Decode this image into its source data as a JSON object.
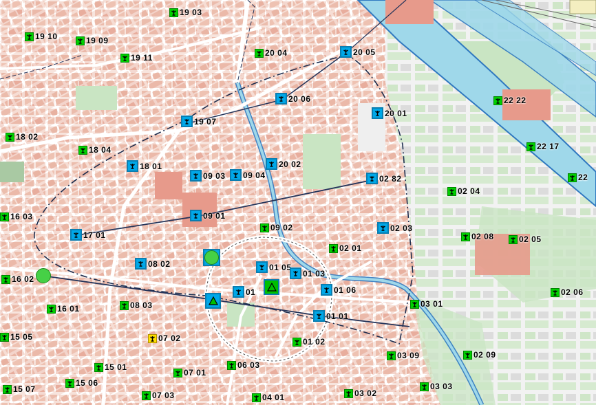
{
  "colors": {
    "urban_block": "#e9b7a6",
    "urban_block_dark": "#e9968a",
    "street": "#ffffff",
    "park": "#c9e5c3",
    "river": "#9fd8ea",
    "river_edge": "#2f78c0",
    "station_green": "#00d000",
    "station_blue": "#00a8e8",
    "station_yellow": "#ffe000",
    "route_line": "#24345a"
  },
  "stations": [
    {
      "label": "19 03",
      "type": "small"
    },
    {
      "label": "19 10",
      "type": "small"
    },
    {
      "label": "19 09",
      "type": "small"
    },
    {
      "label": "19 11",
      "type": "small"
    },
    {
      "label": "20 04",
      "type": "small"
    },
    {
      "label": "20 05",
      "type": "blue"
    },
    {
      "label": "20 06",
      "type": "blue"
    },
    {
      "label": "20 01",
      "type": "blue"
    },
    {
      "label": "22 22",
      "type": "small"
    },
    {
      "label": "19 07",
      "type": "blue"
    },
    {
      "label": "18 02",
      "type": "small"
    },
    {
      "label": "18 04",
      "type": "small"
    },
    {
      "label": "22 17",
      "type": "small"
    },
    {
      "label": "18 01",
      "type": "blue"
    },
    {
      "label": "09 03",
      "type": "blue"
    },
    {
      "label": "09 04",
      "type": "blue"
    },
    {
      "label": "20 02",
      "type": "blue"
    },
    {
      "label": "02 82",
      "type": "blue"
    },
    {
      "label": "22",
      "type": "small"
    },
    {
      "label": "02 04",
      "type": "small"
    },
    {
      "label": "16 03",
      "type": "small"
    },
    {
      "label": "09 01",
      "type": "blue"
    },
    {
      "label": "09 02",
      "type": "small"
    },
    {
      "label": "02 03",
      "type": "blue"
    },
    {
      "label": "17 01",
      "type": "blue"
    },
    {
      "label": "02 08",
      "type": "small"
    },
    {
      "label": "02 05",
      "type": "small"
    },
    {
      "label": "02 01",
      "type": "small"
    },
    {
      "label": "08 02",
      "type": "blue"
    },
    {
      "label": "01 05",
      "type": "blue"
    },
    {
      "label": "01 03",
      "type": "blue"
    },
    {
      "label": "16 02",
      "type": "small"
    },
    {
      "label": "01",
      "type": "blue"
    },
    {
      "label": "01 06",
      "type": "blue"
    },
    {
      "label": "02 06",
      "type": "small"
    },
    {
      "label": "16 01",
      "type": "small"
    },
    {
      "label": "08 03",
      "type": "small"
    },
    {
      "label": "03 01",
      "type": "small"
    },
    {
      "label": "01 01",
      "type": "blue"
    },
    {
      "label": "15 05",
      "type": "small"
    },
    {
      "label": "07 02",
      "type": "yellow"
    },
    {
      "label": "01 02",
      "type": "small"
    },
    {
      "label": "03 09",
      "type": "small"
    },
    {
      "label": "02 09",
      "type": "small"
    },
    {
      "label": "15 01",
      "type": "small"
    },
    {
      "label": "07 01",
      "type": "small"
    },
    {
      "label": "06 03",
      "type": "small"
    },
    {
      "label": "15 07",
      "type": "small"
    },
    {
      "label": "15 06",
      "type": "small"
    },
    {
      "label": "07 03",
      "type": "small"
    },
    {
      "label": "04 01",
      "type": "small"
    },
    {
      "label": "03 02",
      "type": "small"
    },
    {
      "label": "03 03",
      "type": "small"
    }
  ],
  "special_markers": [
    {
      "name": "central-round-station",
      "type": "roundsq"
    },
    {
      "name": "west-round-station",
      "type": "round"
    },
    {
      "name": "triangle-station-a",
      "type": "blue"
    },
    {
      "name": "triangle-station-b",
      "type": "green"
    }
  ]
}
